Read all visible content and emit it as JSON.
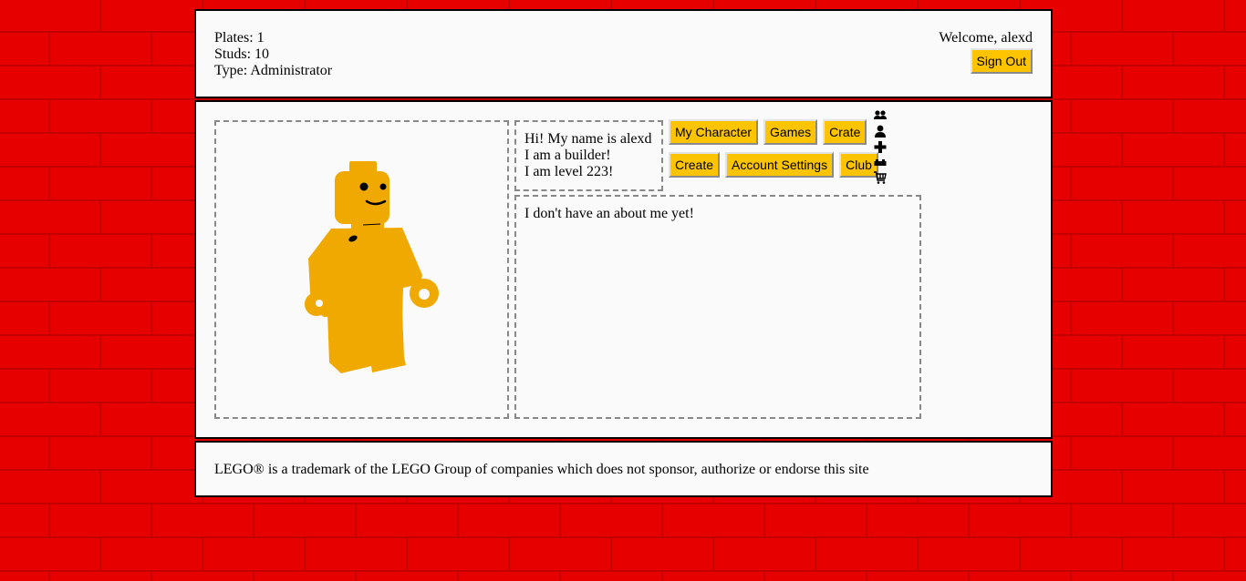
{
  "header": {
    "stats": {
      "plates_label": "Plates: 1",
      "studs_label": "Studs: 10",
      "type_label": "Type: Administrator"
    },
    "welcome": "Welcome, alexd",
    "signout_label": "Sign Out"
  },
  "profile": {
    "greeting": {
      "line1": "Hi! My name is alexd",
      "line2": "I am a builder!",
      "line3": "I am level 223!"
    },
    "about": "I don't have an about me yet!",
    "character": {
      "icon": "minifigure-avatar",
      "color": "#f0a900"
    }
  },
  "nav": {
    "row1": [
      "My Character",
      "Games",
      "Crate"
    ],
    "row2": [
      "Create",
      "Account Settings",
      "Club"
    ]
  },
  "side_icons": [
    "users-icon",
    "user-icon",
    "plus-icon",
    "brick-icon",
    "cart-icon"
  ],
  "footer": {
    "disclaimer": "LEGO® is a trademark of the LEGO Group of companies which does not sponsor, authorize or endorse this site"
  },
  "colors": {
    "background": "#e60000",
    "mortar": "#c30000",
    "button": "#ffc400",
    "panel": "#fafafa"
  }
}
